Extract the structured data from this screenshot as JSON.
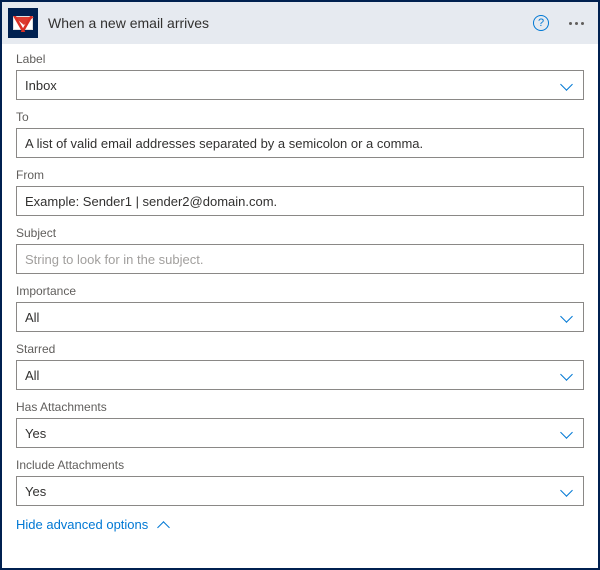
{
  "header": {
    "title": "When a new email arrives"
  },
  "fields": {
    "label": {
      "label": "Label",
      "value": "Inbox"
    },
    "to": {
      "label": "To",
      "placeholder": "A list of valid email addresses separated by a semicolon or a comma."
    },
    "from": {
      "label": "From",
      "placeholder": "Example: Sender1 | sender2@domain.com."
    },
    "subject": {
      "label": "Subject",
      "placeholder": "String to look for in the subject."
    },
    "importance": {
      "label": "Importance",
      "value": "All"
    },
    "starred": {
      "label": "Starred",
      "value": "All"
    },
    "hasAttachments": {
      "label": "Has Attachments",
      "value": "Yes"
    },
    "includeAttachments": {
      "label": "Include Attachments",
      "value": "Yes"
    }
  },
  "footer": {
    "toggleText": "Hide advanced options"
  }
}
